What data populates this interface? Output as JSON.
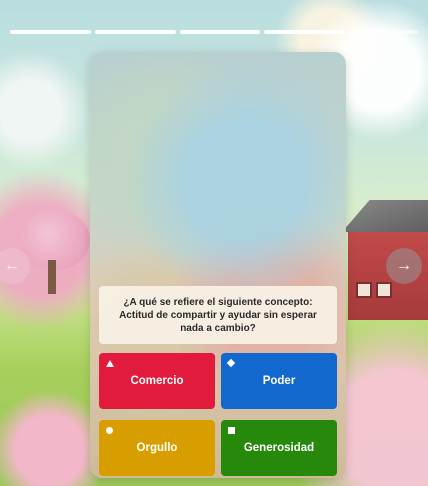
{
  "nav": {
    "prev_icon": "arrow-left-icon",
    "next_icon": "arrow-right-icon",
    "prev_glyph": "←",
    "next_glyph": "→"
  },
  "progress": {
    "segments": 5,
    "completed": 4
  },
  "question": {
    "text": "¿A qué se refiere el siguiente concepto: Actitud de compartir y ayudar sin esperar nada a cambio?"
  },
  "answers": [
    {
      "label": "Comercio",
      "color": "#e21b3c",
      "shape": "triangle-icon"
    },
    {
      "label": "Poder",
      "color": "#1368ce",
      "shape": "diamond-icon"
    },
    {
      "label": "Orgullo",
      "color": "#d89e00",
      "shape": "circle-icon"
    },
    {
      "label": "Generosidad",
      "color": "#26890c",
      "shape": "square-icon"
    }
  ]
}
